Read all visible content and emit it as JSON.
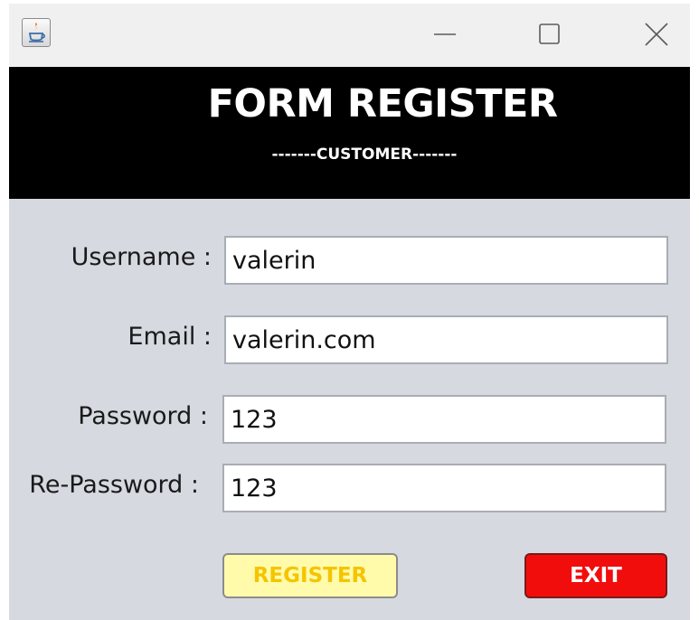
{
  "window": {
    "controls": {
      "minimize_icon": "minimize-icon",
      "maximize_icon": "maximize-icon",
      "close_icon": "close-icon",
      "app_icon": "java-app-icon"
    }
  },
  "header": {
    "title": "FORM REGISTER",
    "subtitle": "-------CUSTOMER-------"
  },
  "form": {
    "username": {
      "label": "Username :",
      "value": "valerin"
    },
    "email": {
      "label": "Email :",
      "value": "valerin.com"
    },
    "password": {
      "label": "Password :",
      "value": "123"
    },
    "repassword": {
      "label": "Re-Password :",
      "value": "123"
    }
  },
  "buttons": {
    "register_label": "REGISTER",
    "exit_label": "EXIT"
  },
  "colors": {
    "header_bg": "#000000",
    "form_bg": "#d6d9e0",
    "register_bg": "#fffbaa",
    "register_text": "#f5c400",
    "exit_bg": "#f20d0d"
  }
}
